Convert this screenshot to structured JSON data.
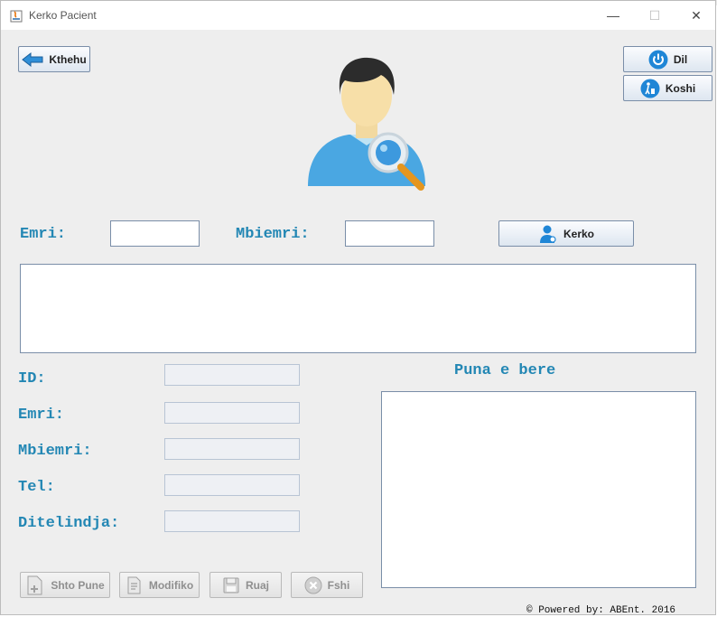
{
  "window": {
    "title": "Kerko Pacient",
    "minimize": "—",
    "maximize": "☐",
    "close": "✕"
  },
  "buttons": {
    "back": "Kthehu",
    "exit": "Dil",
    "trash": "Koshi",
    "search": "Kerko"
  },
  "search": {
    "first_name_label": "Emri:",
    "last_name_label": "Mbiemri:"
  },
  "details": {
    "id_label": "ID:",
    "first_name_label": "Emri:",
    "last_name_label": "Mbiemri:",
    "phone_label": "Tel:",
    "birthdate_label": "Ditelindja:"
  },
  "work": {
    "heading": "Puna e bere"
  },
  "actions": {
    "add_work": "Shto Pune",
    "modify": "Modifiko",
    "save": "Ruaj",
    "delete": "Fshi"
  },
  "footer": {
    "text": "© Powered by: ABEnt. 2016"
  },
  "colors": {
    "label": "#2387b4",
    "accent": "#1f86d6"
  }
}
